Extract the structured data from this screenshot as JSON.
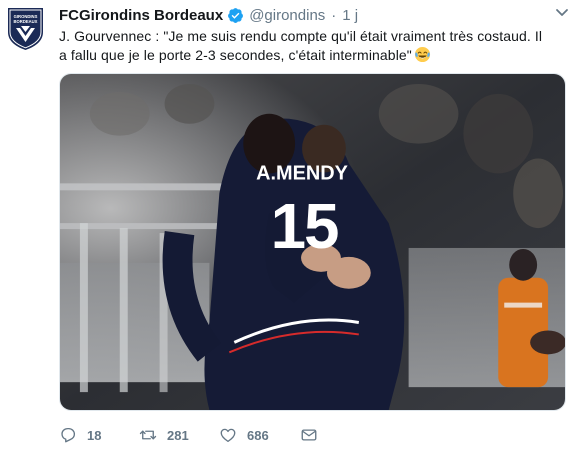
{
  "tweet": {
    "display_name": "FCGirondins Bordeaux",
    "handle": "@girondins",
    "separator": "·",
    "time": "1 j",
    "text": "J. Gourvennec : \"Je me suis rendu compte qu'il était vraiment très costaud. Il a fallu que je le porte 2-3 secondes, c'était interminable\"",
    "emoji": "face-with-tears-of-joy-icon"
  },
  "media": {
    "jersey_name": "A.MENDY",
    "jersey_number": "15"
  },
  "actions": {
    "reply_count": "18",
    "retweet_count": "281",
    "like_count": "686"
  },
  "colors": {
    "brand_navy": "#1b2a56",
    "verified_blue": "#1da1f2",
    "muted_text": "#657786"
  }
}
